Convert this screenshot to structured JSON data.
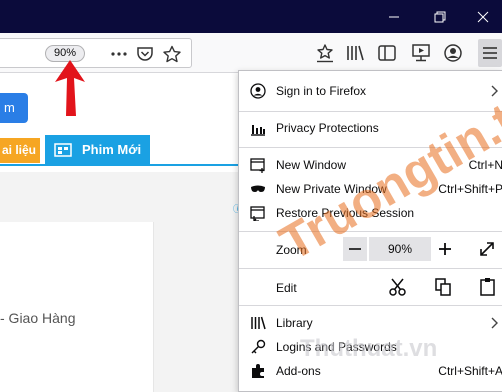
{
  "toolbar": {
    "zoom_badge": "90%",
    "window_controls": [
      "minimize-icon",
      "maximize-icon",
      "close-icon"
    ],
    "url_bar_icons": [
      "more-actions-icon",
      "pocket-icon",
      "bookmark-star-icon"
    ],
    "toolbar_icons": [
      "bookmark-star-box-icon",
      "library-icon",
      "sidebar-icon",
      "media-icon",
      "account-icon",
      "hamburger-menu-icon"
    ]
  },
  "page": {
    "blue_button_fragment": "m",
    "tab_orange_label": "ai liệu",
    "tab_blue_label": "Phim Mới",
    "card_text": "- Giao Hàng"
  },
  "menu": {
    "items": [
      {
        "label": "Sign in to Firefox",
        "icon": "account-icon",
        "has_arrow": true
      },
      {
        "label": "Privacy Protections",
        "icon": "chart-icon"
      },
      {
        "label": "New Window",
        "icon": "new-window-icon",
        "shortcut": "Ctrl+N"
      },
      {
        "label": "New Private Window",
        "icon": "mask-icon",
        "shortcut": "Ctrl+Shift+P"
      },
      {
        "label": "Restore Previous Session",
        "icon": "restore-icon"
      },
      {
        "label": "Zoom",
        "value": "90%"
      },
      {
        "label": "Edit"
      },
      {
        "label": "Library",
        "icon": "library-icon",
        "has_arrow": true
      },
      {
        "label": "Logins and Passwords",
        "icon": "key-icon"
      },
      {
        "label": "Add-ons",
        "icon": "puzzle-icon",
        "shortcut": "Ctrl+Shift+A"
      }
    ]
  },
  "watermark": {
    "main": "Truongtin.top",
    "secondary": "Thuthuat.vn"
  },
  "colors": {
    "titlebar": "#0b0b3b",
    "arrow": "#e2141b",
    "tab_orange": "#f6a623",
    "tab_blue": "#1aa1e3",
    "blue_button": "#2a7ee6"
  }
}
